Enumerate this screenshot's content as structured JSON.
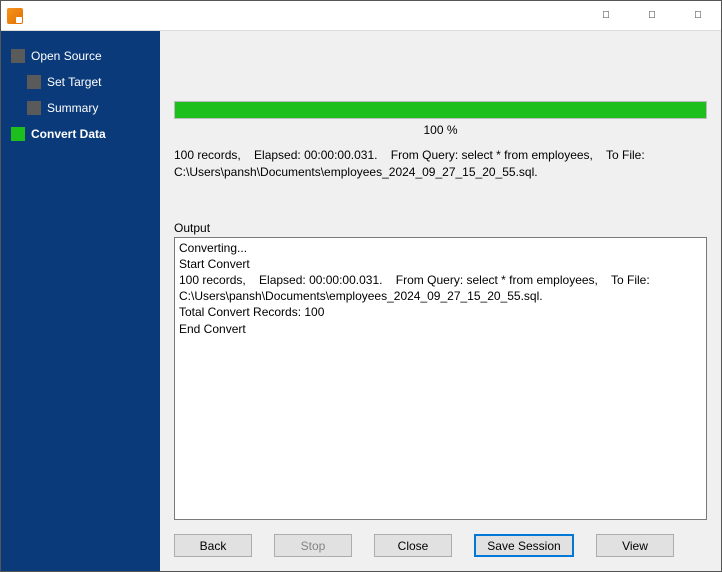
{
  "sidebar": {
    "items": [
      {
        "label": "Open Source",
        "active": false
      },
      {
        "label": "Set Target",
        "active": false
      },
      {
        "label": "Summary",
        "active": false
      },
      {
        "label": "Convert Data",
        "active": true
      }
    ]
  },
  "progress": {
    "percent_text": "100 %"
  },
  "status": "100 records,    Elapsed: 00:00:00.031.    From Query: select * from employees,    To File: C:\\Users\\pansh\\Documents\\employees_2024_09_27_15_20_55.sql.",
  "output_label": "Output",
  "output_text": "Converting...\nStart Convert\n100 records,    Elapsed: 00:00:00.031.    From Query: select * from employees,    To File: C:\\Users\\pansh\\Documents\\employees_2024_09_27_15_20_55.sql.\nTotal Convert Records: 100\nEnd Convert",
  "buttons": {
    "back": "Back",
    "stop": "Stop",
    "close": "Close",
    "save_session": "Save Session",
    "view": "View"
  }
}
